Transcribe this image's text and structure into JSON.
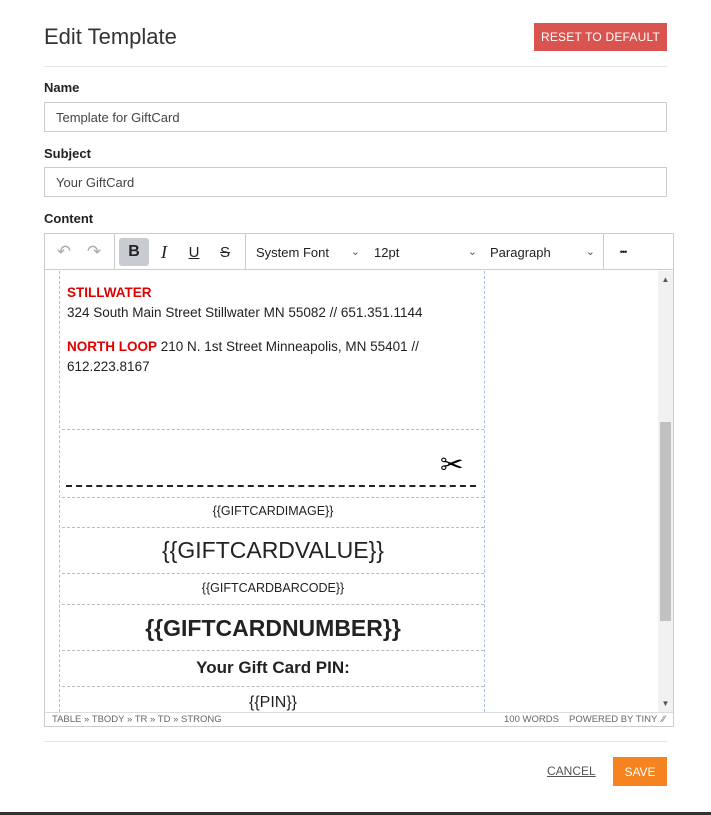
{
  "header": {
    "title": "Edit Template",
    "reset_label": "RESET TO DEFAULT"
  },
  "name_field": {
    "label": "Name",
    "value": "Template for GiftCard"
  },
  "subject_field": {
    "label": "Subject",
    "value": "Your GiftCard"
  },
  "content_label": "Content",
  "toolbar": {
    "undo_icon": "↶",
    "redo_icon": "↷",
    "bold_icon": "B",
    "italic_icon": "I",
    "underline_icon": "U",
    "strike_icon": "S",
    "font_family": "System Font",
    "font_size": "12pt",
    "block_format": "Paragraph",
    "more_icon": "•••"
  },
  "content": {
    "store1_name": "STILLWATER",
    "store1_address": "324 South Main Street Stillwater MN 55082 // 651.351.1144",
    "store2_name": "NORTH LOOP",
    "store2_address": " 210 N. 1st Street Minneapolis, MN 55401 // 612.223.8167",
    "scissors": "✂",
    "giftcard_image": "{{GIFTCARDIMAGE}}",
    "giftcard_value": "{{GIFTCARDVALUE}}",
    "giftcard_barcode": "{{GIFTCARDBARCODE}}",
    "giftcard_number": "{{GIFTCARDNUMBER}}",
    "pin_label": "Your Gift Card PIN:",
    "pin_value": "{{PIN}}"
  },
  "statusbar": {
    "path": "TABLE » TBODY » TR » TD » STRONG",
    "words": "100 WORDS",
    "powered": "POWERED BY TINY"
  },
  "footer": {
    "cancel_label": "CANCEL",
    "save_label": "SAVE"
  },
  "colors": {
    "reset": "#d9534f",
    "save": "#f5831f",
    "store_name": "#e00000"
  }
}
